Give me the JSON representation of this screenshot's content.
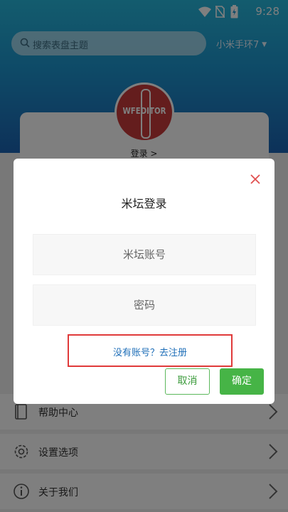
{
  "status_bar": {
    "time": "9:28"
  },
  "header": {
    "search_placeholder": "搜索表盘主题",
    "device_name": "小米手环7",
    "device_caret": "▼"
  },
  "profile": {
    "avatar_text": "WFEDITOR",
    "login_link": "登录 >"
  },
  "menu": {
    "items": [
      {
        "label": "帮助中心"
      },
      {
        "label": "设置选项"
      },
      {
        "label": "关于我们"
      }
    ]
  },
  "dialog": {
    "title": "米坛登录",
    "account_placeholder": "米坛账号",
    "password_placeholder": "密码",
    "register_link": "没有账号？去注册",
    "cancel_label": "取消",
    "confirm_label": "确定"
  },
  "colors": {
    "header_top": "#27b8dc",
    "header_bottom": "#1b63b3",
    "accent_green": "#46b446",
    "link_blue": "#1f6fb8",
    "highlight_red": "#e03a3a"
  }
}
